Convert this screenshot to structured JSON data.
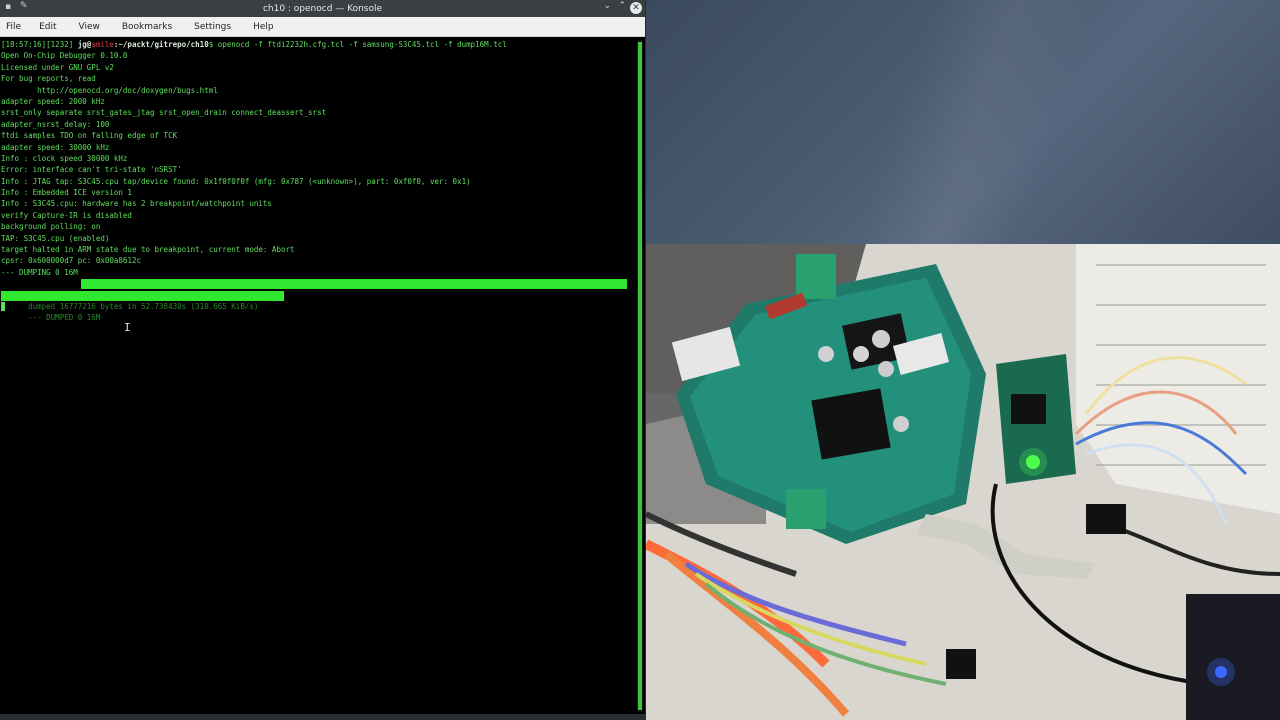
{
  "window": {
    "title": "ch10 : openocd — Konsole",
    "pin_icon": "pin-icon",
    "minimize_icon": "chevron-down-icon",
    "maximize_icon": "chevron-up-icon",
    "close_icon": "close-icon"
  },
  "menu": [
    "File",
    "Edit",
    "View",
    "Bookmarks",
    "Settings",
    "Help"
  ],
  "prompt": {
    "time": "[18:57:16][1232] ",
    "user": "jg@",
    "host": "smile",
    "path": ":~/packt/gitrepo/ch10",
    "command": "$ openocd -f ftdi2232h.cfg.tcl -f samsung-S3C45.tcl -f dump16M.tcl"
  },
  "output_lines": [
    "Open On-Chip Debugger 0.10.0",
    "Licensed under GNU GPL v2",
    "For bug reports, read",
    "        http://openocd.org/doc/doxygen/bugs.html",
    "adapter speed: 2000 kHz",
    "srst_only separate srst_gates_jtag srst_open_drain connect_deassert_srst",
    "adapter_nsrst_delay: 100",
    "ftdi samples TDO on falling edge of TCK",
    "adapter speed: 30000 kHz",
    "Info : clock speed 30000 kHz",
    "Error: interface can't tri-state 'nSRST'",
    "Info : JTAG tap: S3C45.cpu tap/device found: 0x1f0f0f0f (mfg: 0x787 (<unknown>), part: 0xf0f0, ver: 0x1)",
    "Info : Embedded ICE version 1",
    "Info : S3C45.cpu: hardware has 2 breakpoint/watchpoint units",
    "verify Capture-IR is disabled",
    "background polling: on",
    "TAP: S3C45.cpu (enabled)",
    "target halted in ARM state due to breakpoint, current mode: Abort",
    "cpsr: 0x600000d7 pc: 0x00a8612c",
    "--- DUMPING 0 16M"
  ],
  "selected_lines": [
    "dumped 16777216 bytes in 52.738430s (310.665 KiB/s)",
    "--- DUMPED 0 16M"
  ],
  "colors": {
    "terminal_text": "#5fdf5f",
    "selection": "#30e830",
    "titlebar": "#3a3f44",
    "menubar": "#eff0f1"
  },
  "webcam": {
    "description_icon": "camera-feed-icon"
  }
}
